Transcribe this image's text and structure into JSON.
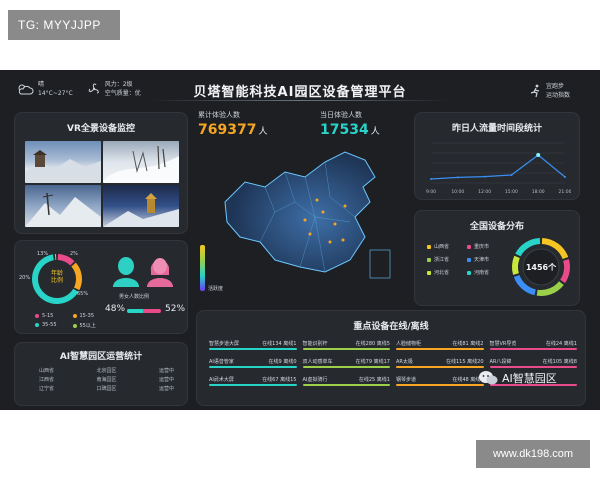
{
  "watermark": "TG: MYYJJPP",
  "site": "www.dk198.com",
  "header": {
    "title": "贝塔智能科技AI园区设备管理平台",
    "weather": {
      "condition": "晴",
      "temp": "14°C~27°C",
      "wind": "风力：2级",
      "air": "空气质量：优"
    },
    "runner": {
      "label1": "宜跑步",
      "label2": "运动指数"
    }
  },
  "vr": {
    "title": "VR全景设备监控"
  },
  "stats": {
    "total_label": "累计体验人数",
    "total_value": "769377",
    "total_unit": "人",
    "today_label": "当日体验人数",
    "today_value": "17534",
    "today_unit": "人"
  },
  "age": {
    "center_line1": "年龄",
    "center_line2": "比例",
    "pct_a": "13%",
    "pct_b": "2%",
    "pct_c": "20%",
    "pct_d": "65%",
    "legend": [
      "5-15",
      "15-35",
      "35-55",
      "55以上"
    ],
    "legend_colors": [
      "#e84a8a",
      "#f5a623",
      "#28d3c7",
      "#9ad04a"
    ],
    "values": [
      13,
      20,
      65,
      2
    ],
    "gender_label": "男女人数比例",
    "male_pct": "48%",
    "female_pct": "52%",
    "male": 48,
    "female": 52
  },
  "ops": {
    "title": "AI智慧园区运营统计",
    "rows": [
      [
        "山西省",
        "北京园区",
        "运营中"
      ],
      [
        "江西省",
        "南海园区",
        "运营中"
      ],
      [
        "辽宁省",
        "口碑园区",
        "运营中"
      ]
    ]
  },
  "map": {
    "legend_label": "活跃度"
  },
  "flow": {
    "title": "昨日人流量时间段统计",
    "chart_data": {
      "type": "line",
      "x": [
        "9:00",
        "10:00",
        "12:00",
        "15:00",
        "18:00",
        "21:00"
      ],
      "values": [
        10,
        14,
        16,
        20,
        70,
        15
      ],
      "ylim": [
        0,
        100
      ],
      "grid": true
    }
  },
  "distribution": {
    "title": "全国设备分布",
    "center": "1456个",
    "items": [
      "山西省",
      "重庆市",
      "浙江省",
      "天津市",
      "河北省",
      "河南省"
    ],
    "colors": [
      "#f5c623",
      "#e84a8a",
      "#9ad04a",
      "#3a8ef6",
      "#c7e83a",
      "#28d3c7"
    ],
    "values": [
      20,
      15,
      18,
      17,
      12,
      18
    ]
  },
  "devices": {
    "title": "重点设备在线/离线",
    "items": [
      {
        "name": "智慧步道大屏",
        "status": "在线134 离线1",
        "color": "#28d3c7"
      },
      {
        "name": "智能识别杆",
        "status": "在线280 离线5",
        "color": "#9ad04a"
      },
      {
        "name": "人脸储物柜",
        "status": "在线81 离线2",
        "color": "#f5a623"
      },
      {
        "name": "智慧VR导览",
        "status": "在线24 离线1",
        "color": "#e84a8a"
      },
      {
        "name": "AI语音管家",
        "status": "在线9 离线0",
        "color": "#28d3c7"
      },
      {
        "name": "双人动感单车",
        "status": "在线79 离线17",
        "color": "#9ad04a"
      },
      {
        "name": "AR太极",
        "status": "在线115 离线20",
        "color": "#f5a623"
      },
      {
        "name": "AR八段锦",
        "status": "在线105 离线8",
        "color": "#e84a8a"
      },
      {
        "name": "AI武术大屏",
        "status": "在线67 离线15",
        "color": "#28d3c7"
      },
      {
        "name": "AI虚拟骑行",
        "status": "在线25 离线1",
        "color": "#9ad04a"
      },
      {
        "name": "钢琴步道",
        "status": "在线48 离线0",
        "color": "#f5a623"
      },
      {
        "name": "",
        "status": "",
        "color": "#e84a8a"
      }
    ]
  },
  "wechat": {
    "label": "AI智慧园区"
  },
  "colors": {
    "cyan": "#28d3c7",
    "orange": "#f5a623",
    "pink": "#e84a8a",
    "green": "#9ad04a",
    "panel": "#26292e",
    "bg": "#1d1f23"
  }
}
